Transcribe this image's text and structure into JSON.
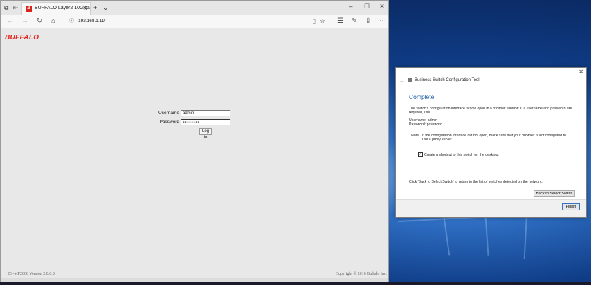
{
  "browser": {
    "tab_title": "BUFFALO Layer2 10Giga",
    "favicon_text": "B",
    "url": "192.168.1.11/"
  },
  "page": {
    "logo": "BUFFALO",
    "username_label": "Username",
    "username_value": "admin",
    "password_label": "Password",
    "password_value": "●●●●●●●●",
    "login_button": "Log In",
    "footer_version": "BS-MP2008 Version 2.0.6.8",
    "footer_copyright": "Copyright © 2016 Buffalo Inc."
  },
  "dialog": {
    "title": "Business Switch Configuration Tool",
    "heading": "Complete",
    "intro": "The switch's configuration interface is now open in a browser window. If a username and password are required, use",
    "username_line": "Username: admin",
    "password_line": "Password: password",
    "note_label": "Note:",
    "note_text": "If the configuration interface did not open, make sure that your browser is not configured to use a proxy server.",
    "shortcut_label": "Create a shortcut to this switch on the desktop.",
    "shortcut_checked": true,
    "back_hint": "Click 'Back to Select Switch' to return to the list of switches detected on the network.",
    "back_button": "Back to Select Switch",
    "finish_button": "Finish"
  }
}
